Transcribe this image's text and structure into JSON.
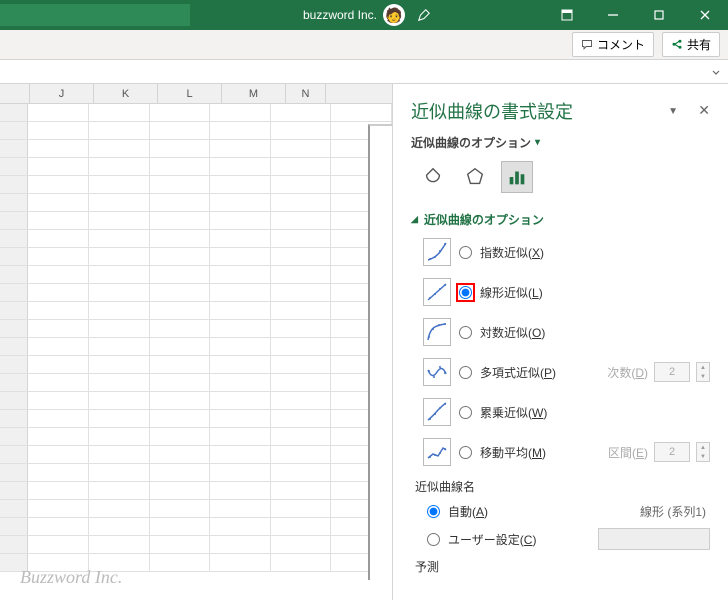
{
  "title_bar": {
    "company": "buzzword Inc.",
    "avatar_emoji": "🧑"
  },
  "ribbon": {
    "comment_label": "コメント",
    "share_label": "共有"
  },
  "columns": [
    "J",
    "K",
    "L",
    "M",
    "N"
  ],
  "watermark": "Buzzword Inc.",
  "pane": {
    "title": "近似曲線の書式設定",
    "subtitle": "近似曲線のオプション",
    "section_title": "近似曲線のオプション",
    "options": {
      "exponential": {
        "label": "指数近似(",
        "key": "X",
        "tail": ")"
      },
      "linear": {
        "label": "線形近似(",
        "key": "L",
        "tail": ")"
      },
      "logarithmic": {
        "label": "対数近似(",
        "key": "O",
        "tail": ")"
      },
      "polynomial": {
        "label": "多項式近似(",
        "key": "P",
        "tail": ")",
        "extra_label": "次数(",
        "extra_key": "D",
        "extra_tail": ")",
        "extra_value": "2"
      },
      "power": {
        "label": "累乗近似(",
        "key": "W",
        "tail": ")"
      },
      "moving_avg": {
        "label": "移動平均(",
        "key": "M",
        "tail": ")",
        "extra_label": "区間(",
        "extra_key": "E",
        "extra_tail": ")",
        "extra_value": "2"
      }
    },
    "name_section": {
      "title": "近似曲線名",
      "auto": {
        "label": "自動(",
        "key": "A",
        "tail": ")"
      },
      "auto_value": "線形 (系列1)",
      "custom": {
        "label": "ユーザー設定(",
        "key": "C",
        "tail": ")"
      }
    },
    "forecast_title": "予測"
  }
}
